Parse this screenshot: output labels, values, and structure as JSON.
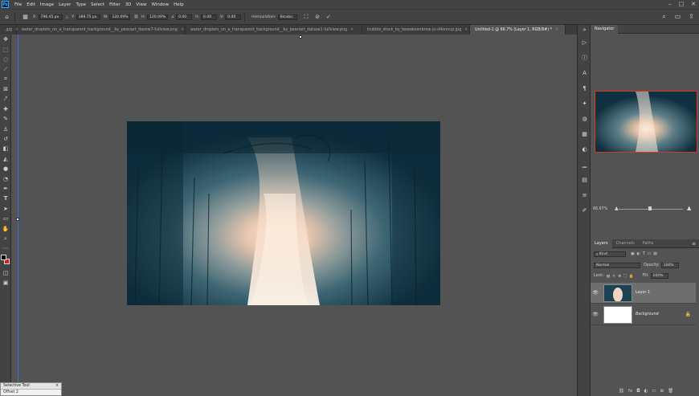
{
  "app": {
    "logo_text": "Ps"
  },
  "menu": [
    "File",
    "Edit",
    "Image",
    "Layer",
    "Type",
    "Select",
    "Filter",
    "3D",
    "View",
    "Window",
    "Help"
  ],
  "options": {
    "x_label": "X:",
    "x_value": "796.45 px",
    "y_label": "Y:",
    "y_value": "389.75 px",
    "w_label": "W:",
    "w_value": "120.09%",
    "h_label": "H:",
    "h_value": "120.09%",
    "angle_value": "0.00",
    "hskew_label": "H:",
    "hskew_value": "0.00",
    "vskew_label": "V:",
    "vskew_value": "0.00",
    "interp_label": "Interpolation:",
    "interp_value": "Bicubic"
  },
  "tabs": [
    {
      "label": ".jpg",
      "active": false
    },
    {
      "label": "water_droplets_on_a_transparent_background__by_pessiart_dasow7-fullview.png",
      "active": false
    },
    {
      "label": "water_droplets_on_a_transparent_background__by_pessiart_dataxe1-fullview.png",
      "active": false
    },
    {
      "label": "trubble_stock_by_bewakoenbrew-jo-d4ennup.jpg",
      "active": false
    },
    {
      "label": "Untitled-1 @ 66.7% (Layer 1, RGB/8#) *",
      "active": true
    }
  ],
  "navigator": {
    "title": "Navigator",
    "zoom": "66.67%"
  },
  "layers_panel": {
    "tabs": [
      "Layers",
      "Channels",
      "Paths"
    ],
    "kind_placeholder": "Kind",
    "blend_mode": "Normal",
    "opacity_label": "Opacity:",
    "opacity_value": "100%",
    "lock_label": "Lock:",
    "fill_label": "Fill:",
    "fill_value": "100%",
    "layers": [
      {
        "name": "Layer 1",
        "selected": true
      },
      {
        "name": "Background",
        "selected": false,
        "locked": true
      }
    ]
  },
  "mini_window": {
    "title": "Selective Tool",
    "text": "Offset 2"
  },
  "colors": {
    "foreground": "#000000",
    "background": "#e01b1b",
    "nav_border": "#e0341f",
    "accent": "#31a8ff"
  }
}
